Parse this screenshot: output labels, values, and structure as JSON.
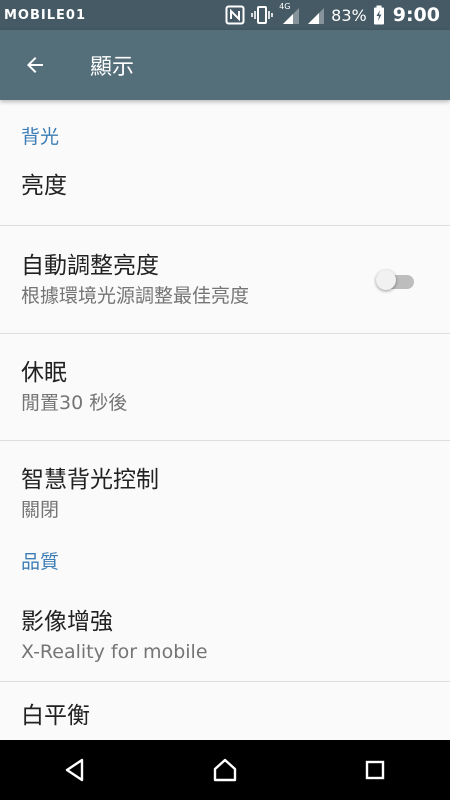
{
  "status_bar": {
    "watermark": "MOBILE01",
    "network": "4G",
    "battery": "83%",
    "time": "9:00",
    "icons": [
      "nfc-icon",
      "vibrate-icon",
      "signal-icon",
      "signal-icon-2",
      "battery-icon"
    ]
  },
  "app_bar": {
    "back_icon": "arrow-back-icon",
    "title": "顯示"
  },
  "sections": {
    "backlight": {
      "header": "背光",
      "brightness": {
        "title": "亮度"
      },
      "auto_brightness": {
        "title": "自動調整亮度",
        "summary": "根據環境光源調整最佳亮度",
        "enabled": false
      },
      "sleep": {
        "title": "休眠",
        "summary": "閒置30 秒後"
      },
      "smart_backlight": {
        "title": "智慧背光控制",
        "summary": "關閉"
      }
    },
    "quality": {
      "header": "品質",
      "image_enhance": {
        "title": "影像增強",
        "summary": "X-Reality for mobile"
      },
      "white_balance": {
        "title": "白平衡"
      }
    }
  },
  "nav_bar": {
    "icons": [
      "back-triangle-icon",
      "home-icon",
      "recents-icon"
    ]
  },
  "colors": {
    "status_bar": "#455a64",
    "app_bar": "#546e7a",
    "accent": "#3c7db6",
    "background": "#fafafa"
  }
}
